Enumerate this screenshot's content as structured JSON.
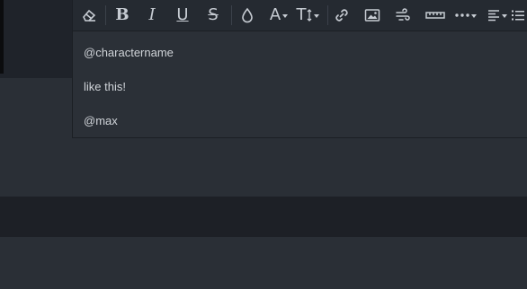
{
  "editor": {
    "paragraphs": [
      "@charactername",
      "like this!",
      "@max"
    ]
  },
  "toolbar": {
    "bold_glyph": "B",
    "italic_glyph": "I",
    "underline_glyph": "U",
    "strike_glyph": "S",
    "font_color_glyph": "A",
    "font_size_glyph": "T",
    "icons": [
      "eraser-icon",
      "bold-icon",
      "italic-icon",
      "underline-icon",
      "strikethrough-icon",
      "color-drop-icon",
      "font-color-icon",
      "font-size-icon",
      "link-icon",
      "image-icon",
      "video-icon",
      "horizontal-rule-icon",
      "more-icon",
      "align-icon",
      "list-icon"
    ]
  },
  "colors": {
    "page_bg": "#2a2f36",
    "toolbar_bg": "#252a31",
    "editor_bg": "#2b3037",
    "dark_band": "#1d2026",
    "icon": "#c7ccd3"
  }
}
